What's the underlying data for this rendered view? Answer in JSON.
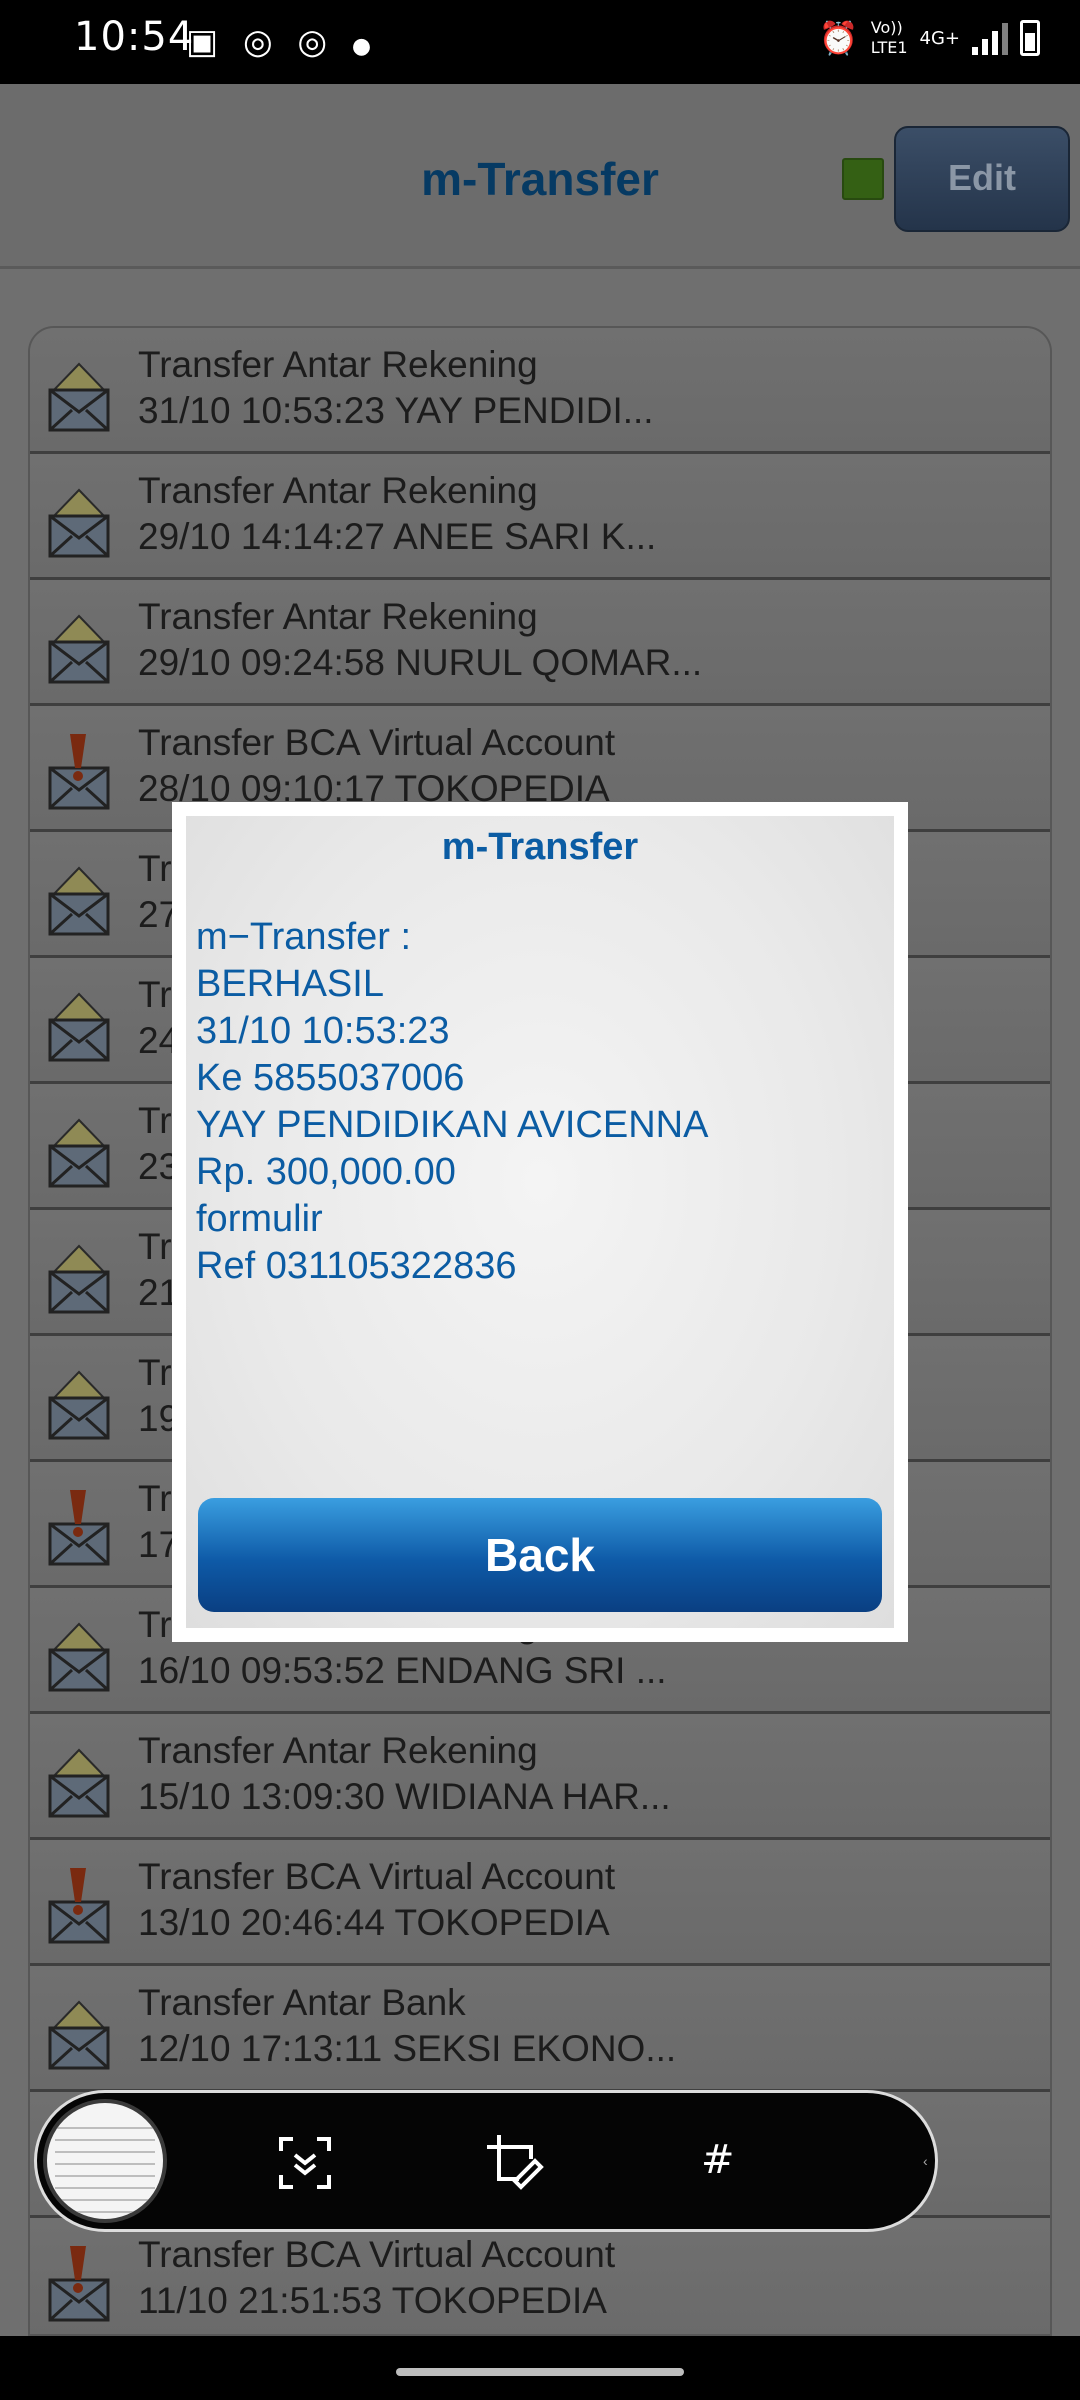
{
  "status_bar": {
    "time": "10:54",
    "network_label_top": "Vo))",
    "network_label_bottom": "LTE1",
    "network_type": "4G+"
  },
  "header": {
    "title": "m-Transfer",
    "edit_label": "Edit"
  },
  "transactions": [
    {
      "type": "Transfer Antar Rekening",
      "detail": "31/10 10:53:23 YAY PENDIDI...",
      "icon": "envelope-icon"
    },
    {
      "type": "Transfer Antar Rekening",
      "detail": "29/10 14:14:27 ANEE SARI K...",
      "icon": "envelope-icon"
    },
    {
      "type": "Transfer Antar Rekening",
      "detail": "29/10 09:24:58 NURUL QOMAR...",
      "icon": "envelope-icon"
    },
    {
      "type": "Transfer BCA Virtual Account",
      "detail": "28/10 09:10:17 TOKOPEDIA",
      "icon": "envelope-alert-icon"
    },
    {
      "type": "Tr",
      "detail": "27",
      "icon": "envelope-icon"
    },
    {
      "type": "Tr",
      "detail": "24",
      "icon": "envelope-icon"
    },
    {
      "type": "Tr",
      "detail": "23",
      "icon": "envelope-icon"
    },
    {
      "type": "Tr",
      "detail": "21",
      "icon": "envelope-icon"
    },
    {
      "type": "Tr",
      "detail": "19",
      "icon": "envelope-icon"
    },
    {
      "type": "Tr",
      "detail": "17",
      "icon": "envelope-alert-icon"
    },
    {
      "type": "Transfer Antar Rekening",
      "detail": "16/10 09:53:52 ENDANG SRI ...",
      "icon": "envelope-icon"
    },
    {
      "type": "Transfer Antar Rekening",
      "detail": "15/10 13:09:30 WIDIANA HAR...",
      "icon": "envelope-icon"
    },
    {
      "type": "Transfer BCA Virtual Account",
      "detail": "13/10 20:46:44 TOKOPEDIA",
      "icon": "envelope-alert-icon"
    },
    {
      "type": "Transfer Antar Bank",
      "detail": "12/10 17:13:11 SEKSI EKONO...",
      "icon": "envelope-icon"
    },
    {
      "type": "",
      "detail": "",
      "icon": "envelope-icon"
    },
    {
      "type": "Transfer BCA Virtual Account",
      "detail": "11/10 21:51:53 TOKOPEDIA",
      "icon": "envelope-alert-icon"
    }
  ],
  "modal": {
    "title": "m-Transfer",
    "lines": [
      "m−Transfer :",
      "BERHASIL",
      "31/10 10:53:23",
      "Ke 5855037006",
      "YAY PENDIDIKAN AVICENNA",
      "Rp. 300,000.00",
      "formulir",
      "Ref 031105322836"
    ],
    "back_label": "Back"
  },
  "screenshot_toolbar": {
    "hash_label": "#"
  },
  "colors": {
    "accent_blue": "#0b5ca3",
    "header_title": "#063a63",
    "indicator_green": "#346014",
    "edit_button": "#24344a"
  }
}
